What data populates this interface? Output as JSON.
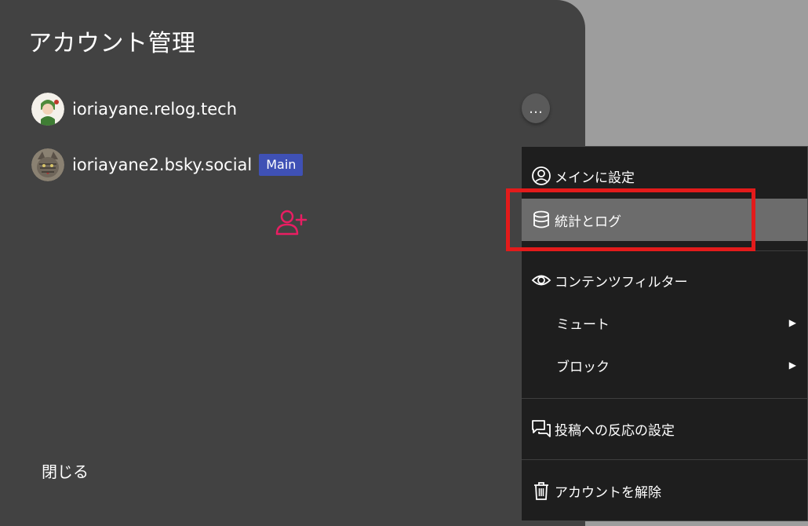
{
  "dialog": {
    "title": "アカウント管理",
    "close_label": "閉じる"
  },
  "accounts": [
    {
      "handle": "ioriayane.relog.tech",
      "badge": ""
    },
    {
      "handle": "ioriayane2.bsky.social",
      "badge": "Main"
    }
  ],
  "more_button": {
    "label": "…"
  },
  "menu": {
    "set_main": "メインに設定",
    "stats_log": "統計とログ",
    "content_filter": "コンテンツフィルター",
    "mute": "ミュート",
    "block": "ブロック",
    "reaction_settings": "投稿への反応の設定",
    "remove_account": "アカウントを解除",
    "submenu_arrow": "▶"
  },
  "colors": {
    "badge": "#3f51b5",
    "add_user_icon": "#e91e63",
    "highlight": "#6c6c6c",
    "callout": "#e31b1b"
  }
}
